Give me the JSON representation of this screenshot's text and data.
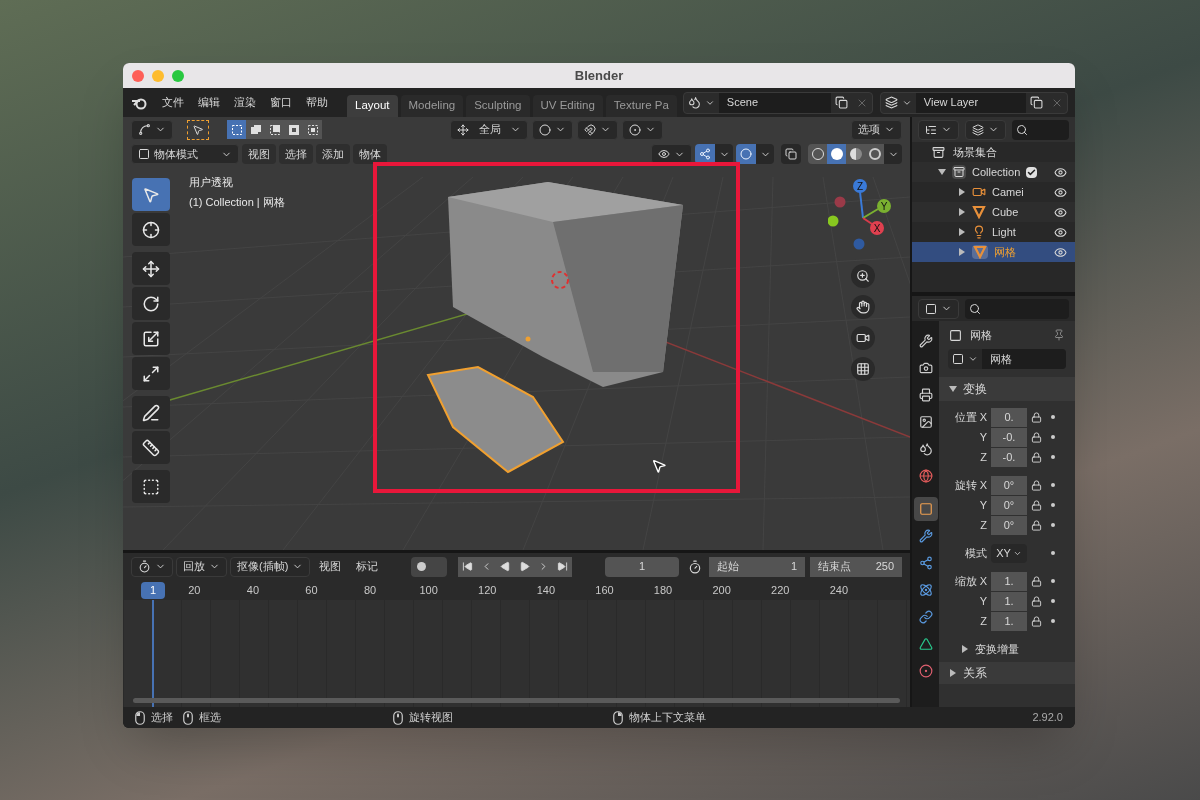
{
  "window": {
    "title": "Blender"
  },
  "menu": [
    "文件",
    "编辑",
    "渲染",
    "窗口",
    "帮助"
  ],
  "workspaces": [
    {
      "label": "Layout",
      "selected": true
    },
    {
      "label": "Modeling",
      "selected": false
    },
    {
      "label": "Sculpting",
      "selected": false
    },
    {
      "label": "UV Editing",
      "selected": false
    },
    {
      "label": "Texture Pa",
      "selected": false
    }
  ],
  "scene": {
    "name": "Scene"
  },
  "view_layer": {
    "name": "View Layer"
  },
  "viewport": {
    "select_modes": [
      {
        "kind": "new",
        "selected": true
      },
      {
        "kind": "extend",
        "selected": false
      },
      {
        "kind": "subtract",
        "selected": false
      },
      {
        "kind": "invert",
        "selected": false
      },
      {
        "kind": "intersect",
        "selected": false
      }
    ],
    "orientation": "全局",
    "options": "选项",
    "mode": "物体模式",
    "menus": [
      "视图",
      "选择",
      "添加",
      "物体"
    ],
    "gizmo_on": true,
    "overlay_on": true,
    "shading": [
      {
        "kind": "wireframe",
        "selected": false
      },
      {
        "kind": "solid",
        "selected": true
      },
      {
        "kind": "material",
        "selected": false
      },
      {
        "kind": "rendered",
        "selected": false
      }
    ],
    "info": [
      "用户透视",
      "(1) Collection | 网格"
    ],
    "tools": [
      {
        "kind": "select",
        "selected": true
      },
      {
        "kind": "cursor",
        "selected": false
      },
      {
        "kind": "move",
        "selected": false
      },
      {
        "kind": "rotate",
        "selected": false
      },
      {
        "kind": "scale",
        "selected": false
      },
      {
        "kind": "transform",
        "selected": false
      },
      {
        "kind": "annotate",
        "selected": false
      },
      {
        "kind": "measure",
        "selected": false
      },
      {
        "kind": "add",
        "selected": false
      }
    ],
    "axes": {
      "x": "X",
      "y": "Y",
      "z": "Z"
    }
  },
  "outliner": {
    "root": "场景集合",
    "collection": {
      "name": "Collection",
      "checked": true,
      "expanded": true,
      "children": [
        {
          "name": "Camei",
          "kind": "camera",
          "selected": false
        },
        {
          "name": "Cube",
          "kind": "mesh",
          "selected": false
        },
        {
          "name": "Light",
          "kind": "light",
          "selected": false
        },
        {
          "name": "网格",
          "kind": "mesh",
          "selected": true
        }
      ]
    }
  },
  "properties": {
    "tabs": [
      {
        "kind": "tool",
        "selected": false
      },
      {
        "kind": "render",
        "selected": false
      },
      {
        "kind": "output",
        "selected": false
      },
      {
        "kind": "view_layer",
        "selected": false
      },
      {
        "kind": "scene",
        "selected": false
      },
      {
        "kind": "world",
        "selected": false
      },
      {
        "kind": "object",
        "selected": true
      },
      {
        "kind": "modifier",
        "selected": false
      },
      {
        "kind": "particles",
        "selected": false
      },
      {
        "kind": "physics",
        "selected": false
      },
      {
        "kind": "constraints",
        "selected": false
      },
      {
        "kind": "data",
        "selected": false
      },
      {
        "kind": "material",
        "selected": false
      }
    ],
    "object_name": "网格",
    "datablock": "网格",
    "panel": {
      "title": "变换",
      "expanded": true,
      "groups": [
        {
          "label": "位置",
          "kind": "vector",
          "rows": [
            {
              "axis": "X",
              "value": "0."
            },
            {
              "axis": "Y",
              "value": "-0."
            },
            {
              "axis": "Z",
              "value": "-0."
            }
          ]
        },
        {
          "label": "旋转",
          "kind": "vector",
          "rows": [
            {
              "axis": "X",
              "value": "0°"
            },
            {
              "axis": "Y",
              "value": "0°"
            },
            {
              "axis": "Z",
              "value": "0°"
            }
          ]
        },
        {
          "label": "模式",
          "kind": "dropdown",
          "value": "XY"
        },
        {
          "label": "缩放",
          "kind": "vector",
          "rows": [
            {
              "axis": "X",
              "value": "1."
            },
            {
              "axis": "Y",
              "value": "1."
            },
            {
              "axis": "Z",
              "value": "1."
            }
          ]
        }
      ],
      "subpanel": {
        "title": "变换增量",
        "expanded": false
      }
    },
    "next_panel": {
      "title": "关系",
      "expanded": false
    }
  },
  "timeline": {
    "menus": [
      "回放",
      "抠像(插帧)",
      "视图",
      "标记"
    ],
    "current_frame": "1",
    "start_label": "起始",
    "start": "1",
    "end_label": "结束点",
    "end": "250",
    "ticks": [
      "20",
      "40",
      "60",
      "80",
      "100",
      "120",
      "140",
      "160",
      "180",
      "200",
      "220",
      "240"
    ],
    "playhead": "1"
  },
  "status_bar": {
    "items": [
      {
        "kind": "left",
        "label": "选择"
      },
      {
        "kind": "middle",
        "label": "框选"
      },
      {
        "kind": "middle",
        "label": "旋转视图"
      },
      {
        "kind": "right",
        "label": "物体上下文菜单"
      }
    ],
    "version": "2.92.0"
  }
}
